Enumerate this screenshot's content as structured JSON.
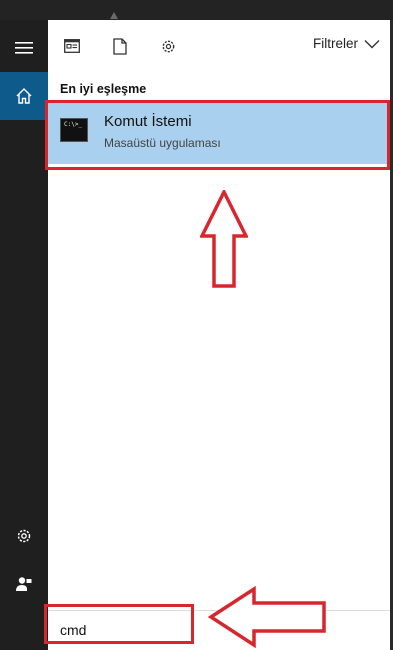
{
  "toolbar": {
    "filters_label": "Filtreler",
    "icons": [
      "document-card-icon",
      "document-icon",
      "gear-icon"
    ]
  },
  "results": {
    "section_title": "En iyi eşleşme",
    "best_match": {
      "title": "Komut İstemi",
      "subtitle": "Masaüstü uygulaması",
      "icon_text": "C:\\>_"
    }
  },
  "search": {
    "query": "cmd"
  },
  "sidebar": {
    "icons": [
      "hamburger-menu-icon",
      "home-icon",
      "gear-icon",
      "user-icon"
    ]
  },
  "colors": {
    "highlight": "#a9d0ee",
    "accent": "#0e5a8a",
    "annotation_red": "#d8262e"
  }
}
